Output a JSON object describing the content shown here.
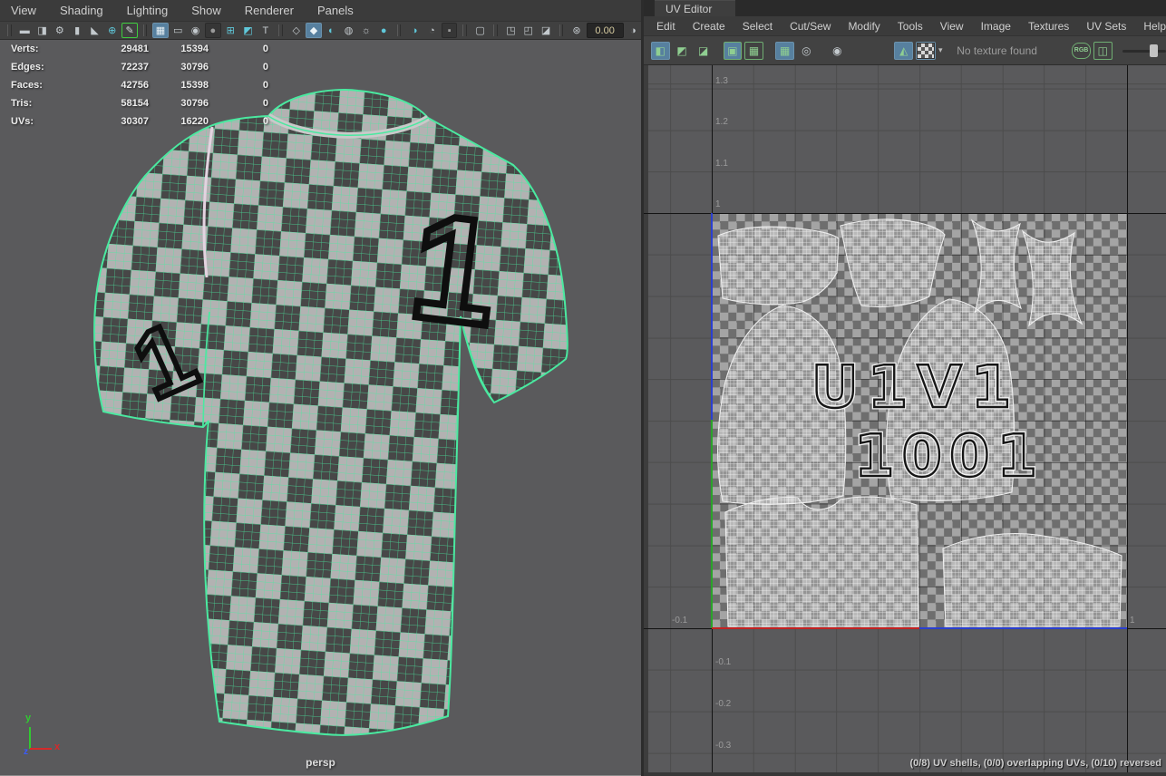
{
  "viewport": {
    "menu": [
      "View",
      "Shading",
      "Lighting",
      "Show",
      "Renderer",
      "Panels"
    ],
    "toolbar": [
      {
        "name": "camera",
        "glyph": "▬"
      },
      {
        "name": "camera-lock",
        "glyph": "◨"
      },
      {
        "name": "camera-settings",
        "glyph": "⚙"
      },
      {
        "name": "bookmark",
        "glyph": "▮"
      },
      {
        "name": "ink-brush",
        "glyph": "◣"
      },
      {
        "name": "pan-zoom",
        "glyph": "⊕"
      },
      {
        "name": "grease-pencil",
        "glyph": "✎"
      },
      {
        "name": "grid",
        "glyph": "▦"
      },
      {
        "name": "film-gate",
        "glyph": "▭"
      },
      {
        "name": "resolution-gate",
        "glyph": "◉"
      },
      {
        "name": "gate-mask",
        "glyph": "●"
      },
      {
        "name": "field-chart",
        "glyph": "⊞"
      },
      {
        "name": "safe-action",
        "glyph": "◩"
      },
      {
        "name": "safe-title",
        "glyph": "T"
      },
      {
        "name": "wireframe-cube",
        "glyph": "◇"
      },
      {
        "name": "smooth-shade",
        "glyph": "◆"
      },
      {
        "name": "textured",
        "glyph": "◐"
      },
      {
        "name": "checkered-sphere",
        "glyph": "◍"
      },
      {
        "name": "lights",
        "glyph": "☼"
      },
      {
        "name": "light-sphere",
        "glyph": "●"
      },
      {
        "name": "shadows",
        "glyph": "◑"
      },
      {
        "name": "ambient-occlusion",
        "glyph": "◔"
      },
      {
        "name": "motion-blur",
        "glyph": "▪"
      },
      {
        "name": "isolate-select",
        "glyph": "▢"
      },
      {
        "name": "snap-copy",
        "glyph": "◳"
      },
      {
        "name": "snap-paste",
        "glyph": "◰"
      },
      {
        "name": "image-plane",
        "glyph": "◪"
      },
      {
        "name": "exposure",
        "glyph": "⊛"
      },
      {
        "name": "gamma",
        "glyph": "◑"
      }
    ],
    "exposure_value": "0.00",
    "hud": {
      "rows": [
        {
          "label": "Verts:",
          "c1": "29481",
          "c2": "15394",
          "c3": "0"
        },
        {
          "label": "Edges:",
          "c1": "72237",
          "c2": "30796",
          "c3": "0"
        },
        {
          "label": "Faces:",
          "c1": "42756",
          "c2": "15398",
          "c3": "0"
        },
        {
          "label": "Tris:",
          "c1": "58154",
          "c2": "30796",
          "c3": "0"
        },
        {
          "label": "UVs:",
          "c1": "30307",
          "c2": "16220",
          "c3": "0"
        }
      ]
    },
    "camera_label": "persp",
    "axis": {
      "x": "x",
      "y": "y",
      "z": "z"
    }
  },
  "uv_editor": {
    "tab_title": "UV Editor",
    "menu": [
      "Edit",
      "Create",
      "Select",
      "Cut/Sew",
      "Modify",
      "Tools",
      "View",
      "Image",
      "Textures",
      "UV Sets",
      "Help"
    ],
    "toolbar": {
      "icons": [
        {
          "name": "tile-layout",
          "glyph": "◧"
        },
        {
          "name": "tile-stack",
          "glyph": "◩"
        },
        {
          "name": "tile-corner",
          "glyph": "◪"
        },
        {
          "name": "texture-borders",
          "glyph": "▣"
        },
        {
          "name": "grid-box",
          "glyph": "▦"
        },
        {
          "name": "pixel-grid",
          "glyph": "▦"
        },
        {
          "name": "dim-image",
          "glyph": "◎"
        },
        {
          "name": "uv-snapshot",
          "glyph": "◉"
        },
        {
          "name": "image-display",
          "glyph": "◭"
        },
        {
          "name": "texture-dropdown",
          "glyph": "▾"
        },
        {
          "name": "image-ratio",
          "glyph": "◫"
        }
      ],
      "no_texture_label": "No texture found",
      "rgb_channels_label": "RGB"
    },
    "grid_labels_v": [
      "1.3",
      "1.2",
      "1.1",
      "1",
      "-0.1",
      "-0.2",
      "-0.3"
    ],
    "grid_labels_u": [
      "-0.1",
      "1"
    ],
    "tile_labels": {
      "uv_tile": "U1V1",
      "udim": "1001"
    },
    "status": "(0/8) UV shells, (0/0) overlapping UVs, (0/10) reversed"
  },
  "colors": {
    "wireframe_green": "#4ae9a0",
    "active_toggle_blue": "#57809f",
    "uv_icon_green": "#8fce91",
    "axis_u_red": "#c32222",
    "axis_v_green": "#2aa32a",
    "tile_border_blue": "#2b3fd0",
    "viewport_bg": "#5a5a5c",
    "checker_light": "#b2b2b2",
    "checker_dark": "#474747"
  }
}
